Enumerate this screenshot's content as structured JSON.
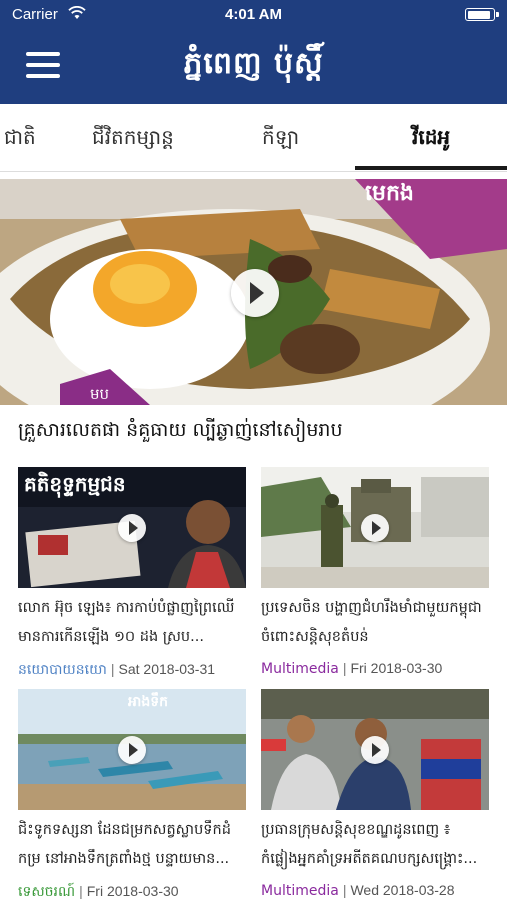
{
  "status_bar": {
    "carrier": "Carrier",
    "time": "4:01 AM",
    "battery_level": 0.95
  },
  "header": {
    "logo_text": "ភ្នំពេញ ប៉ុស្ដិ៍",
    "brand_color": "#1f3e7f"
  },
  "tabs": [
    {
      "label": "ជាតិ",
      "active": false
    },
    {
      "label": "ជីវិតកម្សាន្ត",
      "active": false
    },
    {
      "label": "កីឡា",
      "active": false
    },
    {
      "label": "វីដេអូ",
      "active": true
    }
  ],
  "hero": {
    "title": "គ្រួសារលេតផា នំគួធាយ ល្បីឆ្ងាញ់នៅសៀមរាប",
    "overlay_text": "មេកង",
    "badge_text": "មប"
  },
  "cards": [
    {
      "title": "លោក អ៊ុច ឡេង៖ ការកាប់បំផ្លាញព្រៃឈើមានការកើនឡើង ១០ ដង ស្រប...",
      "category": "នយោបាយនយោ",
      "category_color": "#4f82c4",
      "date": "Sat 2018-03-31",
      "thumb_caption": "គតិខុទ្ទកម្មជន"
    },
    {
      "title": "ប្រទេសចិន បង្ហាញជំហរឹងមាំជាមួយកម្ពុជាចំពោះសន្តិសុខតំបន់",
      "category": "Multimedia",
      "category_color": "#8a2a9e",
      "date": "Fri 2018-03-30",
      "thumb_caption": ""
    },
    {
      "title": "ជិះទូកទស្សនា ដែនជម្រកសត្វស្លាបទឹកដំកម្រ នៅអាងទឹកត្រពាំងថ្ម បន្ទាយមាន...",
      "category": "ទេសចរណ៍",
      "category_color": "#3a9a3a",
      "date": "Fri 2018-03-30",
      "thumb_caption": "អាងទឹក"
    },
    {
      "title": "ប្រធានក្រុមសន្តិសុខខណ្ឌដូនពេញ ៖ កំផ្លៀងអ្នកគាំទ្រអតីតគណបក្សសង្គ្រោះ...",
      "category": "Multimedia",
      "category_color": "#8a2a9e",
      "date": "Wed 2018-03-28",
      "thumb_caption": ""
    }
  ]
}
